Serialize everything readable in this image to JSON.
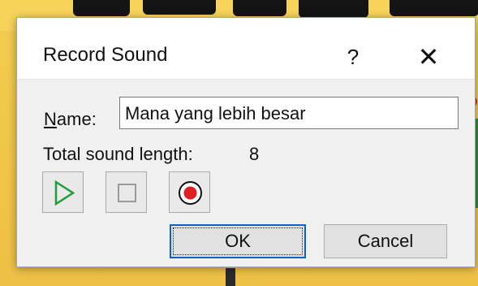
{
  "dialog": {
    "title": "Record Sound",
    "help_label": "?",
    "close_label": "✕",
    "name_label_first": "N",
    "name_label_rest": "ame:",
    "name_value": "Mana yang lebih besar",
    "length_label": "Total sound length:",
    "length_value": "8",
    "ok_label": "OK",
    "cancel_label": "Cancel"
  },
  "icons": {
    "play": "play-icon",
    "stop": "stop-icon",
    "record": "record-icon"
  },
  "colors": {
    "play_icon": "#1f9b3a",
    "record_icon": "#e02020",
    "focus_border": "#0a64c8",
    "slide_background": "#f1c84a"
  }
}
